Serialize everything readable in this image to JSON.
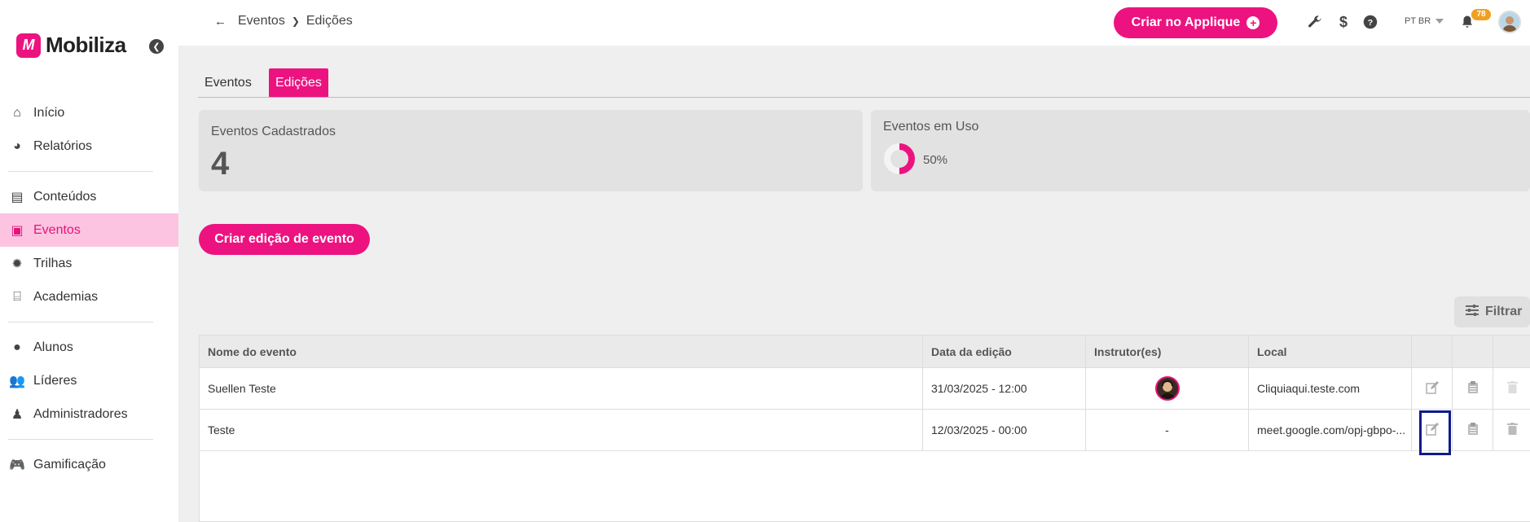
{
  "sidebar": {
    "brand": "Mobiliza",
    "brand_mark": "M",
    "items": [
      {
        "label": "Início",
        "icon": "home-icon",
        "glyph": "⌂",
        "active": false
      },
      {
        "label": "Relatórios",
        "icon": "pie-chart-icon",
        "glyph": "◕",
        "active": false
      },
      {
        "label": "Conteúdos",
        "icon": "archive-icon",
        "glyph": "▤",
        "active": false
      },
      {
        "label": "Eventos",
        "icon": "presentation-icon",
        "glyph": "▣",
        "active": true
      },
      {
        "label": "Trilhas",
        "icon": "badge-icon",
        "glyph": "✹",
        "active": false
      },
      {
        "label": "Academias",
        "icon": "institution-icon",
        "glyph": "⌸",
        "active": false
      },
      {
        "label": "Alunos",
        "icon": "user-circle-icon",
        "glyph": "●",
        "active": false
      },
      {
        "label": "Líderes",
        "icon": "users-icon",
        "glyph": "👥",
        "active": false
      },
      {
        "label": "Administradores",
        "icon": "user-tie-icon",
        "glyph": "♟",
        "active": false
      },
      {
        "label": "Gamificação",
        "icon": "gamepad-icon",
        "glyph": "🎮",
        "active": false
      }
    ]
  },
  "topbar": {
    "breadcrumb": [
      "Eventos",
      "Edições"
    ],
    "create_button": "Criar no Applique",
    "lang": "PT BR",
    "notifications": "78"
  },
  "tabs": [
    {
      "label": "Eventos",
      "active": false
    },
    {
      "label": "Edições",
      "active": true
    }
  ],
  "stats": {
    "registered_title": "Eventos Cadastrados",
    "registered_value": "4",
    "in_use_title": "Eventos em Uso",
    "in_use_percent": "50%",
    "in_use_fraction": 0.5
  },
  "create_edition_button": "Criar edição de evento",
  "filter_button": "Filtrar",
  "table": {
    "columns": [
      "Nome do evento",
      "Data da edição",
      "Instrutor(es)",
      "Local"
    ],
    "rows": [
      {
        "name": "Suellen Teste",
        "date": "31/03/2025 - 12:00",
        "instructor": "",
        "local": "Cliquiaqui.teste.com"
      },
      {
        "name": "Teste",
        "date": "12/03/2025 - 00:00",
        "instructor": "-",
        "local": "meet.google.com/opj-gbpo-..."
      }
    ]
  },
  "colors": {
    "accent": "#ec1380",
    "highlight": "#101a8a",
    "badge": "#f0a020"
  }
}
